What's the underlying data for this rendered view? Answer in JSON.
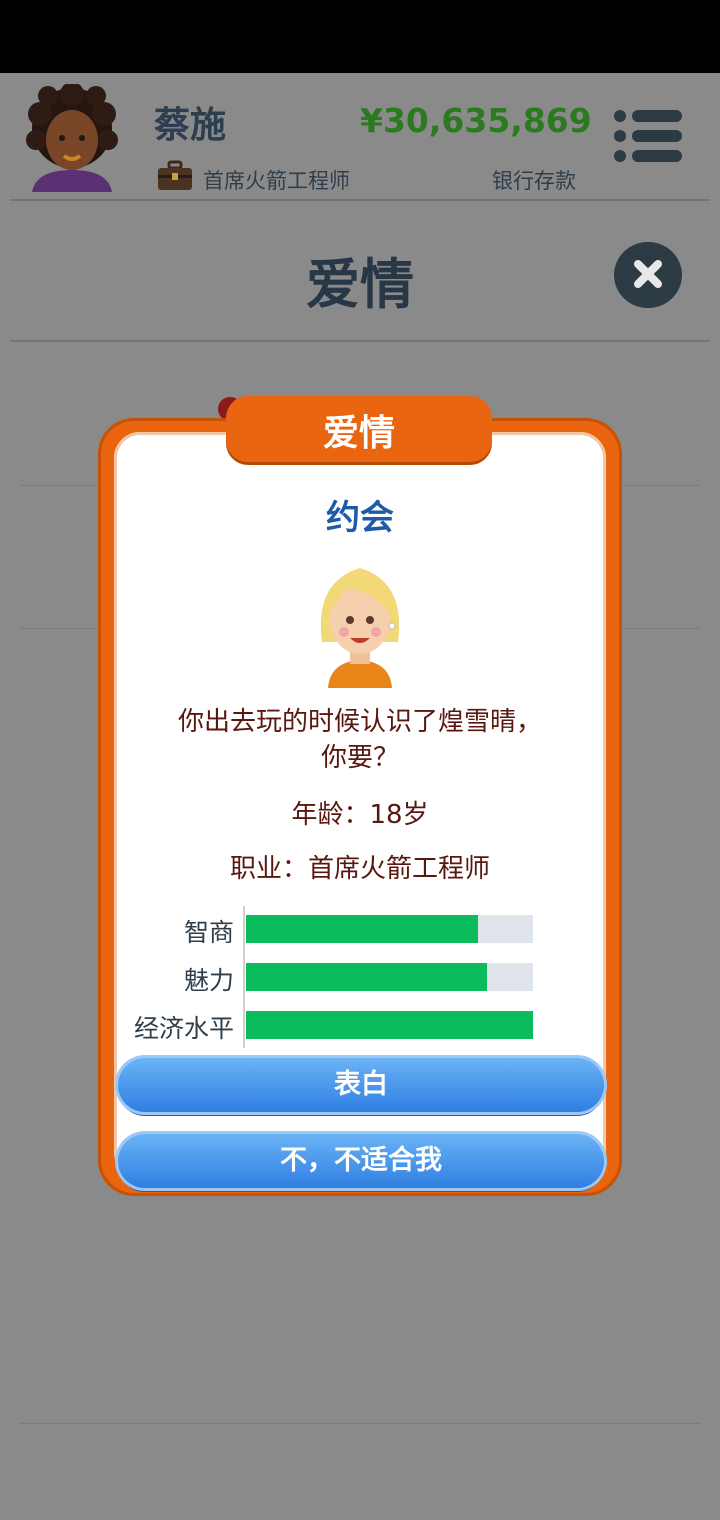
{
  "header": {
    "player_name": "蔡施",
    "player_job": "首席火箭工程师",
    "money": "¥30,635,869",
    "money_label": "银行存款",
    "icons": {
      "avatar": "player-avatar",
      "briefcase": "briefcase-icon",
      "menu": "menu-icon"
    }
  },
  "page": {
    "title": "爱情",
    "close_icon": "close-icon"
  },
  "modal": {
    "tab_title": "爱情",
    "section_title": "约会",
    "message_line1": "你出去玩的时候认识了煌雪晴，",
    "message_line2": "你要？",
    "age": "年龄：18岁",
    "job": "职业：首席火箭工程师",
    "stats": [
      {
        "label": "智商",
        "value": 0.81
      },
      {
        "label": "魅力",
        "value": 0.84
      },
      {
        "label": "经济水平",
        "value": 1.0
      }
    ],
    "buttons": {
      "confess": "表白",
      "decline": "不，不适合我"
    }
  },
  "colors": {
    "orange": "#e9650f",
    "title_blue": "#1d5aa8",
    "bar_green": "#0cbc5c",
    "money_green": "#2b7a20",
    "text_brown": "#5a1710"
  }
}
